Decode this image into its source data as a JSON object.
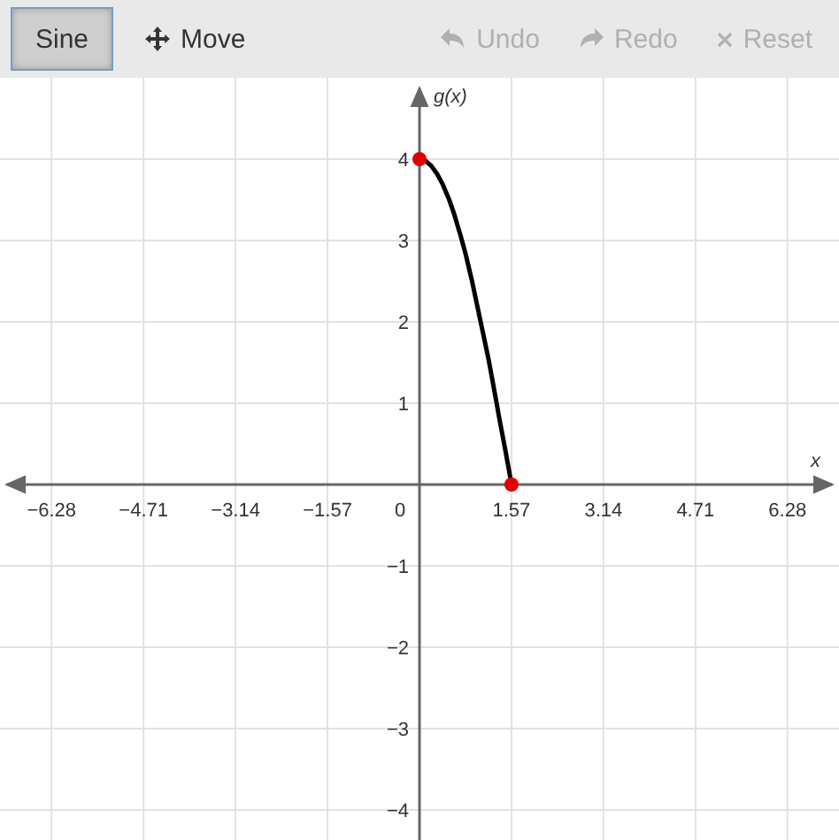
{
  "toolbar": {
    "tools": [
      {
        "label": "Sine",
        "kind": "plain",
        "selected": true
      },
      {
        "label": "Move",
        "kind": "move",
        "selected": false
      }
    ],
    "actions": [
      {
        "label": "Undo",
        "kind": "undo",
        "disabled": true
      },
      {
        "label": "Redo",
        "kind": "redo",
        "disabled": true
      },
      {
        "label": "Reset",
        "kind": "reset",
        "disabled": true
      }
    ]
  },
  "graph": {
    "origin_label": "0",
    "chart_data": {
      "type": "line",
      "grid": true,
      "xlabel": "x",
      "ylabel": "g(x)",
      "xlim": [
        -7.16,
        7.16
      ],
      "ylim": [
        -4.37,
        5
      ],
      "xticks": [
        {
          "value": -6.28,
          "label": "−6.28"
        },
        {
          "value": -4.71,
          "label": "−4.71"
        },
        {
          "value": -3.14,
          "label": "−3.14"
        },
        {
          "value": -1.57,
          "label": "−1.57"
        },
        {
          "value": 1.57,
          "label": "1.57"
        },
        {
          "value": 3.14,
          "label": "3.14"
        },
        {
          "value": 4.71,
          "label": "4.71"
        },
        {
          "value": 6.28,
          "label": "6.28"
        }
      ],
      "yticks": [
        {
          "value": 4,
          "label": "4"
        },
        {
          "value": 3,
          "label": "3"
        },
        {
          "value": 2,
          "label": "2"
        },
        {
          "value": 1,
          "label": "1"
        },
        {
          "value": -1,
          "label": "−1"
        },
        {
          "value": -2,
          "label": "−2"
        },
        {
          "value": -3,
          "label": "−3"
        },
        {
          "value": -4,
          "label": "−4"
        }
      ],
      "x": [
        0,
        0.1,
        0.2,
        0.3,
        0.39,
        0.5,
        0.59,
        0.7,
        0.79,
        0.9,
        0.98,
        1.1,
        1.18,
        1.3,
        1.37,
        1.47,
        1.57
      ],
      "series": [
        {
          "color": "#000000",
          "values": [
            4,
            3.98,
            3.92,
            3.82,
            3.7,
            3.51,
            3.33,
            3.06,
            2.83,
            2.49,
            2.22,
            1.81,
            1.53,
            1.07,
            0.79,
            0.4,
            0
          ]
        }
      ]
    }
  }
}
